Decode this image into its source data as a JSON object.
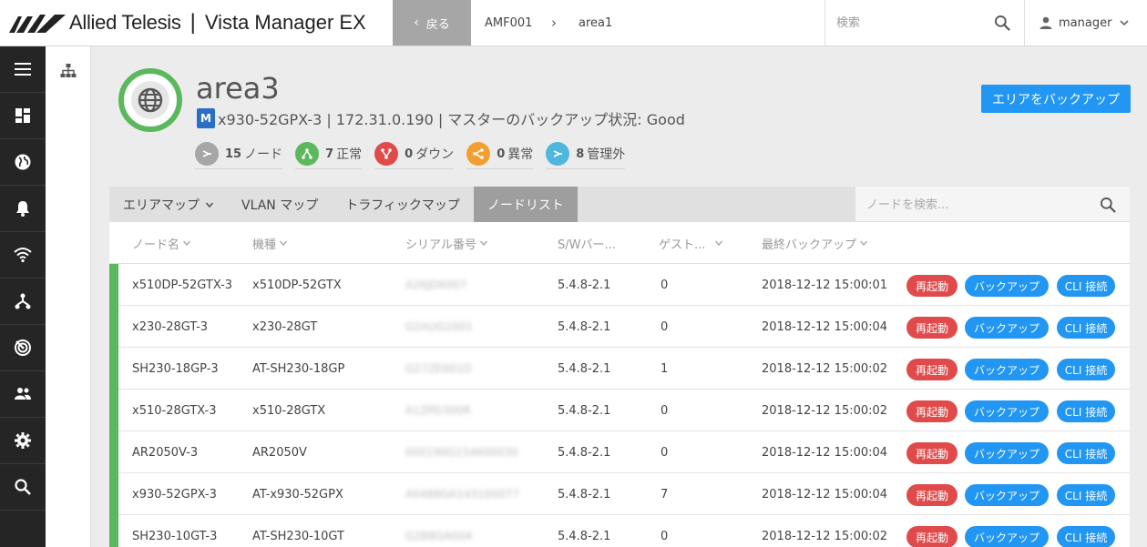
{
  "header": {
    "brand": "Allied Telesis",
    "separator": "|",
    "product": "Vista Manager EX",
    "back_label": "戻る",
    "breadcrumb": [
      "AMF001",
      "area1"
    ],
    "search_placeholder": "検索",
    "user": "manager"
  },
  "sidebar": {
    "items": [
      "menu-icon",
      "dashboard-icon",
      "globe-icon",
      "alarm-icon",
      "wifi-icon",
      "network-icon",
      "radar-icon",
      "users-icon",
      "gear-icon",
      "search-icon"
    ]
  },
  "area": {
    "name": "area3",
    "badge": "M",
    "subtitle": "x930-52GPX-3 | 172.31.0.190 | マスターのバックアップ状況: Good",
    "backup_button": "エリアをバックアップ",
    "stats": [
      {
        "count": "15",
        "label": "ノード",
        "color": "#9e9e9e"
      },
      {
        "count": "7",
        "label": "正常",
        "color": "#5cb85c"
      },
      {
        "count": "0",
        "label": "ダウン",
        "color": "#e04a4a"
      },
      {
        "count": "0",
        "label": "異常",
        "color": "#f0a030"
      },
      {
        "count": "8",
        "label": "管理外",
        "color": "#4fb6dd"
      }
    ]
  },
  "tabs": [
    {
      "label": "エリアマップ"
    },
    {
      "label": "VLAN マップ"
    },
    {
      "label": "トラフィックマップ"
    },
    {
      "label": "ノードリスト"
    }
  ],
  "node_search_placeholder": "ノードを検索...",
  "table": {
    "columns": [
      "ノード名",
      "機種",
      "シリアル番号",
      "S/Wバー...",
      "ゲスト...",
      "最終バックアップ"
    ],
    "actions": {
      "restart": "再起動",
      "backup": "バックアップ",
      "cli": "CLI 接続"
    },
    "rows": [
      {
        "name": "x510DP-52GTX-3",
        "model": "x510DP-52GTX",
        "serial": "A2KJD6007",
        "sw": "5.4.8-2.1",
        "guest": "0",
        "backup": "2018-12-12 15:00:01"
      },
      {
        "name": "x230-28GT-3",
        "model": "x230-28GT",
        "serial": "G2AUG2001",
        "sw": "5.4.8-2.1",
        "guest": "0",
        "backup": "2018-12-12 15:00:04"
      },
      {
        "name": "SH230-18GP-3",
        "model": "AT-SH230-18GP",
        "serial": "G27ZE601D",
        "sw": "5.4.8-2.1",
        "guest": "1",
        "backup": "2018-12-12 15:00:02"
      },
      {
        "name": "x510-28GTX-3",
        "model": "x510-28GTX",
        "serial": "A1ZPD300R",
        "sw": "5.4.8-2.1",
        "guest": "0",
        "backup": "2018-12-12 15:00:02"
      },
      {
        "name": "AR2050V-3",
        "model": "AR2050V",
        "serial": "000190G154600030",
        "sw": "5.4.8-2.1",
        "guest": "0",
        "backup": "2018-12-12 15:00:04"
      },
      {
        "name": "x930-52GPX-3",
        "model": "AT-x930-52GPX",
        "serial": "A0488GA143100077",
        "sw": "5.4.8-2.1",
        "guest": "7",
        "backup": "2018-12-12 15:00:04"
      },
      {
        "name": "SH230-10GT-3",
        "model": "AT-SH230-10GT",
        "serial": "G2B8GA004",
        "sw": "5.4.8-2.1",
        "guest": "0",
        "backup": "2018-12-12 15:00:02"
      }
    ]
  }
}
